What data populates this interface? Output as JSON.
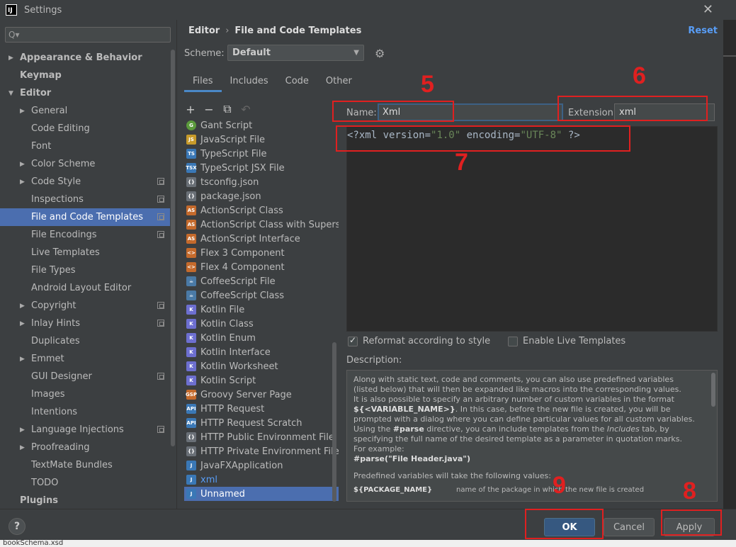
{
  "window": {
    "title": "Settings",
    "app_icon": "IJ",
    "close_label": "✕"
  },
  "search": {
    "placeholder": "Q▾"
  },
  "tree": [
    {
      "label": "Appearance & Behavior",
      "level": 0,
      "bold": true,
      "arrow": "▶"
    },
    {
      "label": "Keymap",
      "level": 0,
      "bold": true,
      "arrow": ""
    },
    {
      "label": "Editor",
      "level": 0,
      "bold": true,
      "arrow": "▼"
    },
    {
      "label": "General",
      "level": 1,
      "arrow": "▶"
    },
    {
      "label": "Code Editing",
      "level": 1,
      "arrow": ""
    },
    {
      "label": "Font",
      "level": 1,
      "arrow": ""
    },
    {
      "label": "Color Scheme",
      "level": 1,
      "arrow": "▶"
    },
    {
      "label": "Code Style",
      "level": 1,
      "arrow": "▶",
      "copy": true
    },
    {
      "label": "Inspections",
      "level": 1,
      "arrow": "",
      "copy": true
    },
    {
      "label": "File and Code Templates",
      "level": 1,
      "arrow": "",
      "copy": true,
      "selected": true
    },
    {
      "label": "File Encodings",
      "level": 1,
      "arrow": "",
      "copy": true
    },
    {
      "label": "Live Templates",
      "level": 1,
      "arrow": ""
    },
    {
      "label": "File Types",
      "level": 1,
      "arrow": ""
    },
    {
      "label": "Android Layout Editor",
      "level": 1,
      "arrow": ""
    },
    {
      "label": "Copyright",
      "level": 1,
      "arrow": "▶",
      "copy": true
    },
    {
      "label": "Inlay Hints",
      "level": 1,
      "arrow": "▶",
      "copy": true
    },
    {
      "label": "Duplicates",
      "level": 1,
      "arrow": ""
    },
    {
      "label": "Emmet",
      "level": 1,
      "arrow": "▶"
    },
    {
      "label": "GUI Designer",
      "level": 1,
      "arrow": "",
      "copy": true
    },
    {
      "label": "Images",
      "level": 1,
      "arrow": ""
    },
    {
      "label": "Intentions",
      "level": 1,
      "arrow": ""
    },
    {
      "label": "Language Injections",
      "level": 1,
      "arrow": "▶",
      "copy": true
    },
    {
      "label": "Proofreading",
      "level": 1,
      "arrow": "▶"
    },
    {
      "label": "TextMate Bundles",
      "level": 1,
      "arrow": ""
    },
    {
      "label": "TODO",
      "level": 1,
      "arrow": ""
    },
    {
      "label": "Plugins",
      "level": 0,
      "bold": true,
      "arrow": ""
    }
  ],
  "breadcrumb": {
    "first": "Editor",
    "separator": "›",
    "second": "File and Code Templates"
  },
  "reset_label": "Reset",
  "scheme": {
    "label": "Scheme:",
    "value": "Default",
    "caret": "▼"
  },
  "gear_icon": "⚙",
  "tabs": [
    "Files",
    "Includes",
    "Code",
    "Other"
  ],
  "toolbar": {
    "add": "+",
    "remove": "−",
    "copy": "⧉",
    "reset": "↶"
  },
  "files": [
    {
      "label": "Gant Script",
      "icon": "G",
      "color": "#5b9a3c",
      "round": true
    },
    {
      "label": "JavaScript File",
      "icon": "JS",
      "color": "#c79a2a"
    },
    {
      "label": "TypeScript File",
      "icon": "TS",
      "color": "#3a78b6"
    },
    {
      "label": "TypeScript JSX File",
      "icon": "TSX",
      "color": "#3a78b6"
    },
    {
      "label": "tsconfig.json",
      "icon": "{}",
      "color": "#6a7077"
    },
    {
      "label": "package.json",
      "icon": "{}",
      "color": "#6a7077"
    },
    {
      "label": "ActionScript Class",
      "icon": "AS",
      "color": "#c46a2c"
    },
    {
      "label": "ActionScript Class with Supers",
      "icon": "AS",
      "color": "#c46a2c"
    },
    {
      "label": "ActionScript Interface",
      "icon": "AS",
      "color": "#c46a2c"
    },
    {
      "label": "Flex 3 Component",
      "icon": "<>",
      "color": "#c46a2c"
    },
    {
      "label": "Flex 4 Component",
      "icon": "<>",
      "color": "#c46a2c"
    },
    {
      "label": "CoffeeScript File",
      "icon": "☕",
      "color": "#4a7aa6"
    },
    {
      "label": "CoffeeScript Class",
      "icon": "☕",
      "color": "#4a7aa6"
    },
    {
      "label": "Kotlin File",
      "icon": "K",
      "color": "#6d6fd0"
    },
    {
      "label": "Kotlin Class",
      "icon": "K",
      "color": "#6d6fd0"
    },
    {
      "label": "Kotlin Enum",
      "icon": "K",
      "color": "#6d6fd0"
    },
    {
      "label": "Kotlin Interface",
      "icon": "K",
      "color": "#6d6fd0"
    },
    {
      "label": "Kotlin Worksheet",
      "icon": "K",
      "color": "#6d6fd0"
    },
    {
      "label": "Kotlin Script",
      "icon": "K",
      "color": "#6d6fd0"
    },
    {
      "label": "Groovy Server Page",
      "icon": "GSP",
      "color": "#c46a2c"
    },
    {
      "label": "HTTP Request",
      "icon": "API",
      "color": "#3a78b6"
    },
    {
      "label": "HTTP Request Scratch",
      "icon": "API",
      "color": "#3a78b6"
    },
    {
      "label": "HTTP Public Environment File",
      "icon": "{}",
      "color": "#6a7077"
    },
    {
      "label": "HTTP Private Environment File",
      "icon": "{}",
      "color": "#6a7077"
    },
    {
      "label": "JavaFXApplication",
      "icon": "J",
      "color": "#3a78b6"
    },
    {
      "label": "xml",
      "icon": "J",
      "color": "#3a78b6",
      "blue": true
    },
    {
      "label": "Unnamed",
      "icon": "J",
      "color": "#3a78b6",
      "selected": true
    }
  ],
  "name_field": {
    "label": "Name:",
    "value": "Xml"
  },
  "extension_field": {
    "label": "Extension:",
    "value": "xml"
  },
  "editor": {
    "p1": "<?xml version=",
    "s1": "\"1.0\"",
    "p2": " encoding=",
    "s2": "\"UTF-8\"",
    "p3": " ?>"
  },
  "reformat": {
    "label": "Reformat according to style",
    "checked": true
  },
  "live_templates": {
    "label": "Enable Live Templates",
    "checked": false
  },
  "description": {
    "label": "Description:",
    "lines": [
      "Along with static text, code and comments, you can also use predefined variables",
      "(listed below) that will then be expanded like macros into the corresponding values.",
      "It is also possible to specify an arbitrary number of custom variables in the format"
    ],
    "var_format": "${<VARIABLE_NAME>}",
    "line4_rest": ". In this case, before the new file is created, you will be",
    "line5": "prompted with a dialog where you can define particular values for all custom variables.",
    "line6_a": "Using the ",
    "line6_b": "#parse",
    "line6_c": " directive, you can include templates from the ",
    "line6_d": "Includes",
    "line6_e": " tab, by",
    "line7": "specifying the full name of the desired template as a parameter in quotation marks.",
    "line8": "For example:",
    "example": "#parse(\"File Header.java\")",
    "predefined": "Predefined variables will take the following values:",
    "var_name": "${PACKAGE_NAME}",
    "var_desc": "name of the package in which the new file is created"
  },
  "buttons": {
    "help": "?",
    "ok": "OK",
    "cancel": "Cancel",
    "apply": "Apply"
  },
  "annotations": {
    "n5": "5",
    "n6": "6",
    "n7": "7",
    "n8": "8",
    "n9": "9"
  },
  "background_peek": "bookSchema.xsd"
}
